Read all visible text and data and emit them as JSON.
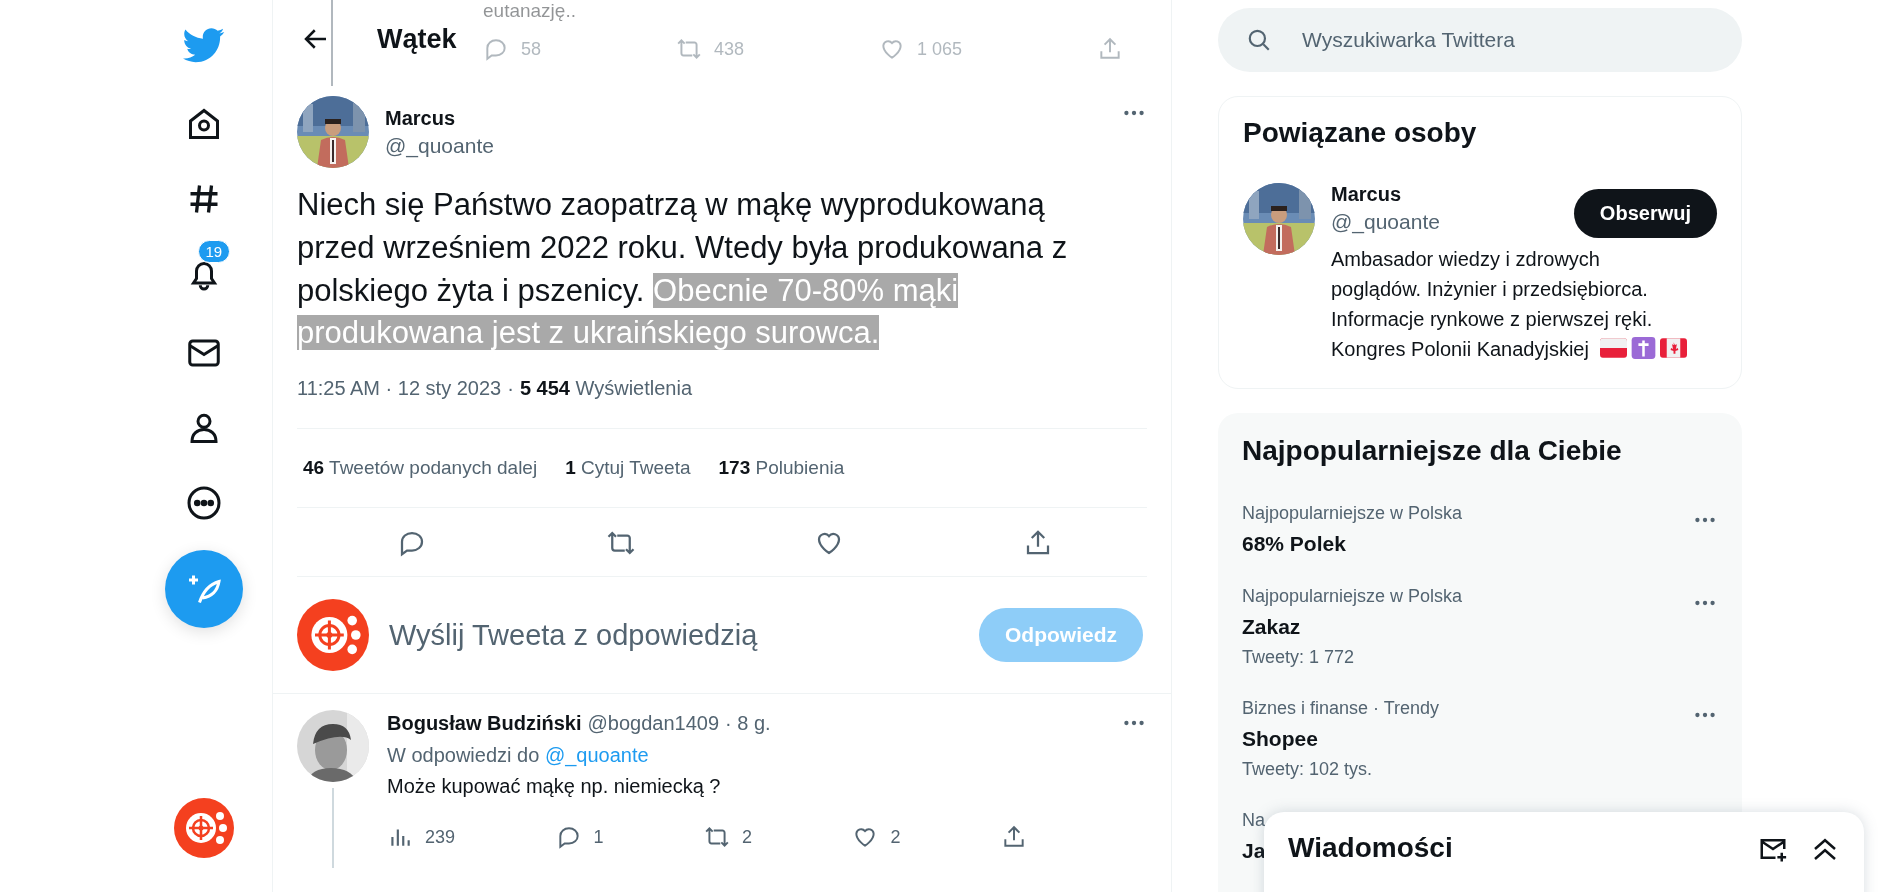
{
  "nav": {
    "notifications_badge": "19"
  },
  "header": {
    "title": "Wątek"
  },
  "previous_tweet": {
    "text": "eutanazję..",
    "replies": "58",
    "retweets": "438",
    "likes": "1 065"
  },
  "tweet": {
    "name": "Marcus",
    "handle": "@_quoante",
    "text": [
      {
        "text": "Niech się Państwo zaopatrzą w mąkę wyprodukowaną przed wrześniem 2022 roku. Wtedy była produkowana z polskiego żyta i pszenicy. ",
        "highlighted": false
      },
      {
        "text": "Obecnie 70-80% mąki produkowana jest z ukraińskiego surowca.",
        "highlighted": true
      }
    ],
    "time": "11:25 AM · 12 sty 2023",
    "separator": "·",
    "views_count": "5 454",
    "views_label": "Wyświetlenia",
    "stats": [
      {
        "count": "46",
        "label": "Tweetów podanych dalej"
      },
      {
        "count": "1",
        "label": "Cytuj Tweeta"
      },
      {
        "count": "173",
        "label": "Polubienia"
      }
    ]
  },
  "composer": {
    "placeholder": "Wyślij Tweeta z odpowiedzią",
    "button": "Odpowiedz",
    "button_disabled": true
  },
  "replies": [
    {
      "name": "Bogusław Budziński",
      "handle": "@bogdan1409",
      "time": "· 8 g.",
      "replying_to_label": "W odpowiedzi do",
      "replying_to": "@_quoante",
      "text": "Może kupować mąkę np. niemiecką ?",
      "views": "239",
      "replies": "1",
      "retweets": "2",
      "likes": "2"
    }
  ],
  "search": {
    "placeholder": "Wyszukiwarka Twittera"
  },
  "related": {
    "title": "Powiązane osoby",
    "people": [
      {
        "name": "Marcus",
        "handle": "@_quoante",
        "bio": [
          "Ambasador wiedzy i zdrowych",
          "poglądów. Inżynier i przedsiębiorca.",
          "Informacje rynkowe z pierwszej ręki.",
          "Kongres Polonii Kanadyjskiej"
        ],
        "button": "Obserwuj"
      }
    ]
  },
  "trends": {
    "title": "Najpopularniejsze dla Ciebie",
    "items": [
      {
        "context": "Najpopularniejsze w Polska",
        "name": "68% Polek"
      },
      {
        "context": "Najpopularniejsze w Polska",
        "name": "Zakaz",
        "count": "Tweety: 1 772"
      },
      {
        "context": "Biznes i finanse · Trendy",
        "name": "Shopee",
        "count": "Tweety: 102 tys."
      }
    ],
    "covered_item": {
      "context": "Na",
      "name": "Ja"
    }
  },
  "messages": {
    "title": "Wiadomości"
  }
}
